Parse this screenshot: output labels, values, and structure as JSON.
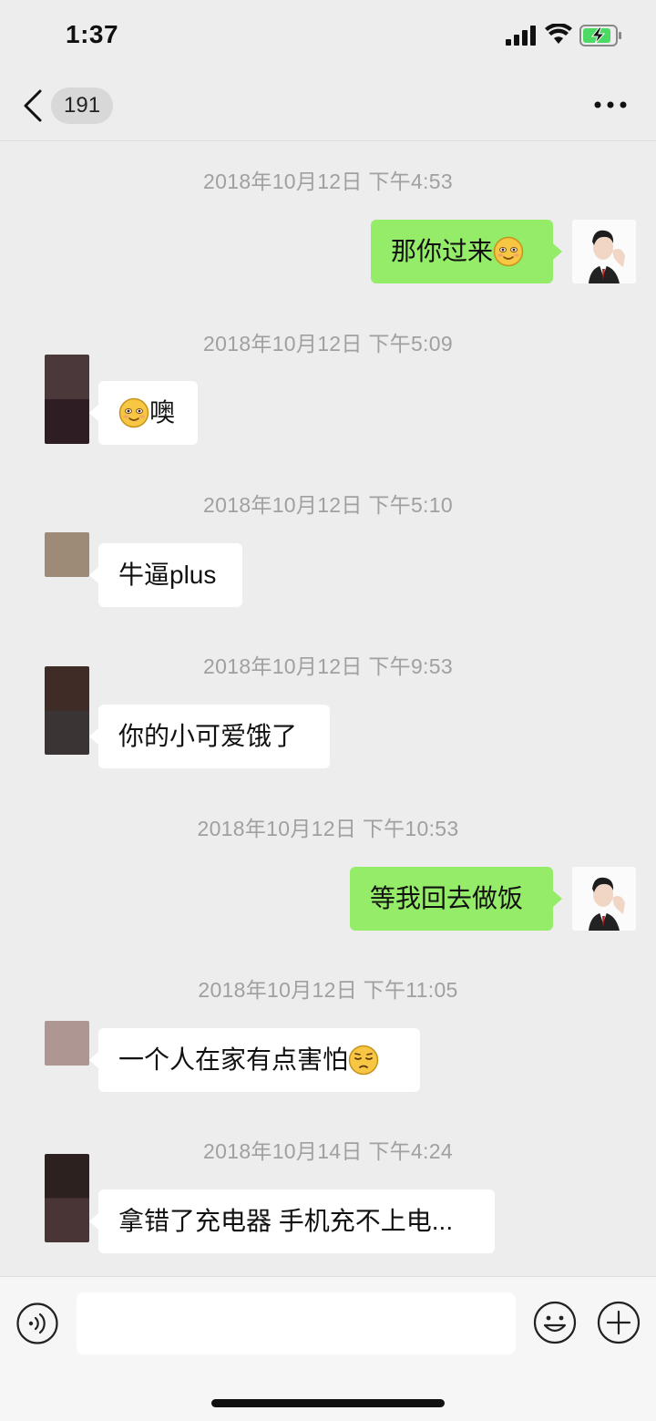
{
  "status_bar": {
    "time": "1:37",
    "battery_charging": true
  },
  "nav": {
    "unread_count": "191"
  },
  "colors": {
    "outgoing_bubble": "#95ec69",
    "incoming_bubble": "#ffffff",
    "background": "#ededed"
  },
  "messages": [
    {
      "timestamp": "2018年10月12日 下午4:53",
      "direction": "out",
      "text": "那你过来",
      "emoji_after": "smile"
    },
    {
      "timestamp": "2018年10月12日 下午5:09",
      "direction": "in",
      "emoji_before": "smile",
      "text": "噢"
    },
    {
      "timestamp": "2018年10月12日 下午5:10",
      "direction": "in",
      "text": "牛逼plus"
    },
    {
      "timestamp": "2018年10月12日 下午9:53",
      "direction": "in",
      "text": "你的小可爱饿了"
    },
    {
      "timestamp": "2018年10月12日 下午10:53",
      "direction": "out",
      "text": "等我回去做饭"
    },
    {
      "timestamp": "2018年10月12日 下午11:05",
      "direction": "in",
      "text": "一个人在家有点害怕",
      "emoji_after": "pensive"
    },
    {
      "timestamp": "2018年10月14日 下午4:24",
      "direction": "in",
      "text": "拿错了充电器 手机充不上电..."
    }
  ],
  "input_bar": {
    "icons": [
      "voice-icon",
      "emoji-icon",
      "plus-icon"
    ]
  }
}
